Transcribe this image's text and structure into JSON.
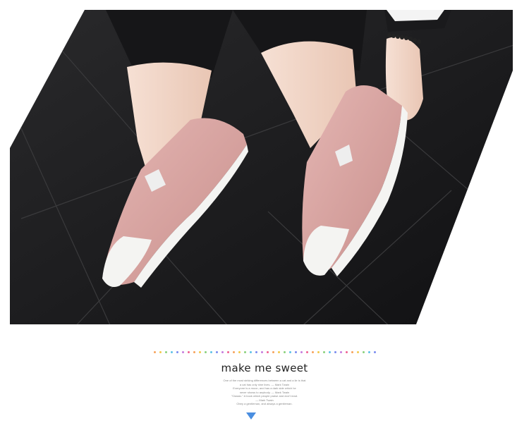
{
  "caption": {
    "title": "make me sweet",
    "quote_lines": [
      "One of the most striking differences between a cat and a lie is that",
      "a cat has only nine lives. — Mark Twain",
      "Everyone is a moon, and has a dark side which he",
      "never shows to anybody. — Mark Twain",
      "\"Classic.\" A book which people praise and don't read.",
      "— Mark Twain",
      "Obey a gentleman, and always a gentleman."
    ]
  },
  "colors": {
    "floor": "#1b1b1d",
    "shoe_pink": "#d9a7a4",
    "sole": "#f4f4f2",
    "skin": "#f2d7c9",
    "pants": "#161618",
    "arrow": "#4a8ee0",
    "dots": [
      "#f7a35c",
      "#f2c94c",
      "#8bd17c",
      "#5ec2e8",
      "#7a8cf0",
      "#c77dde",
      "#f06292",
      "#f7a35c",
      "#f2c94c",
      "#8bd17c",
      "#5ec2e8",
      "#7a8cf0",
      "#c77dde",
      "#f06292",
      "#f7a35c",
      "#f2c94c",
      "#8bd17c",
      "#5ec2e8",
      "#7a8cf0",
      "#c77dde",
      "#f06292",
      "#f7a35c",
      "#f2c94c",
      "#8bd17c",
      "#5ec2e8",
      "#7a8cf0",
      "#c77dde",
      "#f06292",
      "#f7a35c",
      "#f2c94c",
      "#8bd17c",
      "#5ec2e8",
      "#7a8cf0",
      "#c77dde",
      "#f06292",
      "#f7a35c",
      "#f2c94c",
      "#8bd17c",
      "#5ec2e8",
      "#7a8cf0"
    ]
  },
  "icons": {
    "down_arrow": "down-arrow-icon"
  }
}
